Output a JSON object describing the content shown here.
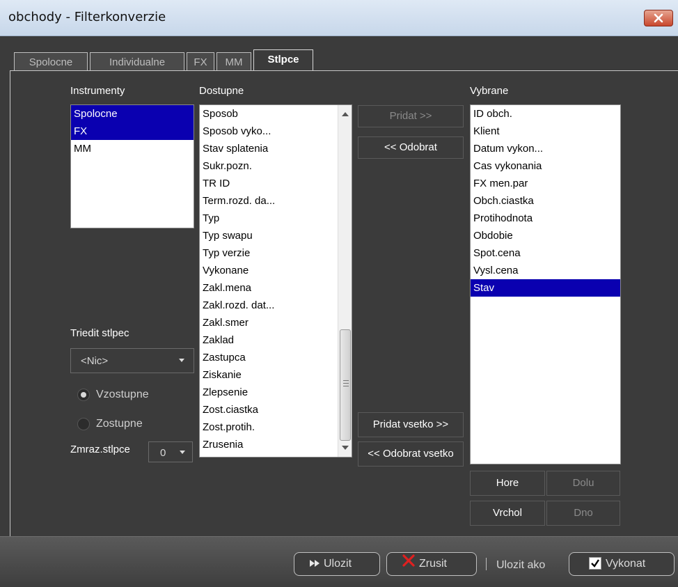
{
  "window": {
    "title": "obchody - Filterkonverzie"
  },
  "tabs": [
    "Spolocne",
    "Individualne",
    "FX",
    "MM",
    "Stlpce"
  ],
  "instruments": {
    "label": "Instrumenty",
    "items": [
      "Spolocne",
      "FX",
      "MM"
    ],
    "selected": [
      "Spolocne",
      "FX"
    ]
  },
  "available": {
    "label": "Dostupne",
    "items": [
      "Sposob",
      "Sposob vyko...",
      "Stav splatenia",
      "Sukr.pozn.",
      "TR ID",
      "Term.rozd. da...",
      "Typ",
      "Typ swapu",
      "Typ verzie",
      "Vykonane",
      "Zakl.mena",
      "Zakl.rozd. dat...",
      "Zakl.smer",
      "Zaklad",
      "Zastupca",
      "Ziskanie",
      "Zlepsenie",
      "Zost.ciastka",
      "Zost.protih.",
      "Zrusenia"
    ]
  },
  "selected_cols": {
    "label": "Vybrane",
    "items": [
      "ID obch.",
      "Klient",
      "Datum vykon...",
      "Cas vykonania",
      "FX men.par",
      "Obch.ciastka",
      "Protihodnota",
      "Obdobie",
      "Spot.cena",
      "Vysl.cena",
      "Stav"
    ],
    "selected": "Stav"
  },
  "buttons": {
    "add": "Pridat >>",
    "remove": "<< Odobrat",
    "add_all": "Pridat vsetko >>",
    "remove_all": "<< Odobrat vsetko",
    "up": "Hore",
    "down": "Dolu",
    "top": "Vrchol",
    "bottom": "Dno"
  },
  "sort": {
    "label": "Triedit stlpec",
    "value": "<Nic>",
    "asc": "Vzostupne",
    "desc": "Zostupne",
    "selected": "Vzostupne"
  },
  "freeze": {
    "label": "Zmraz.stlpce",
    "value": "0"
  },
  "footer": {
    "save": "Ulozit",
    "cancel": "Zrusit",
    "save_as": "Ulozit ako",
    "execute": "Vykonat"
  },
  "colors": {
    "selection": "#0a00b0",
    "background": "#3b3b3b",
    "cancel_x": "#e02020"
  }
}
